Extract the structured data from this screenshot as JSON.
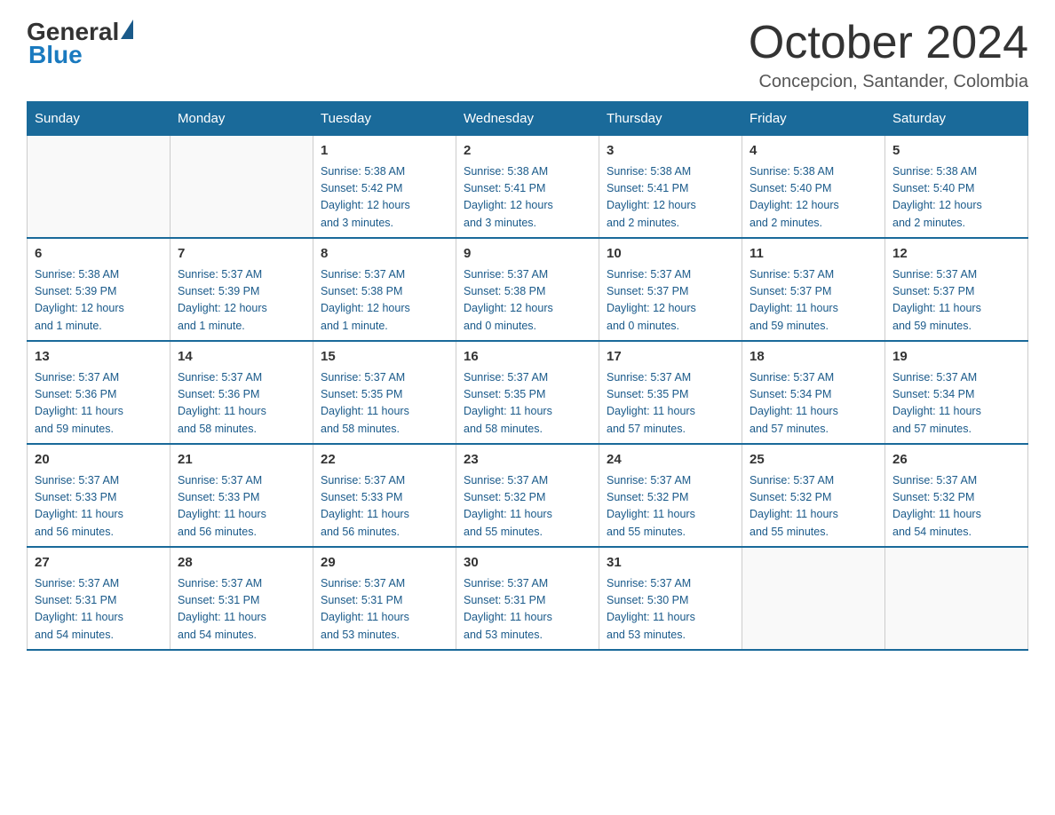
{
  "logo": {
    "general": "General",
    "triangle_color": "#1a5a8a",
    "blue": "Blue"
  },
  "header": {
    "title": "October 2024",
    "subtitle": "Concepcion, Santander, Colombia"
  },
  "weekdays": [
    "Sunday",
    "Monday",
    "Tuesday",
    "Wednesday",
    "Thursday",
    "Friday",
    "Saturday"
  ],
  "weeks": [
    [
      {
        "day": "",
        "info": ""
      },
      {
        "day": "",
        "info": ""
      },
      {
        "day": "1",
        "info": "Sunrise: 5:38 AM\nSunset: 5:42 PM\nDaylight: 12 hours\nand 3 minutes."
      },
      {
        "day": "2",
        "info": "Sunrise: 5:38 AM\nSunset: 5:41 PM\nDaylight: 12 hours\nand 3 minutes."
      },
      {
        "day": "3",
        "info": "Sunrise: 5:38 AM\nSunset: 5:41 PM\nDaylight: 12 hours\nand 2 minutes."
      },
      {
        "day": "4",
        "info": "Sunrise: 5:38 AM\nSunset: 5:40 PM\nDaylight: 12 hours\nand 2 minutes."
      },
      {
        "day": "5",
        "info": "Sunrise: 5:38 AM\nSunset: 5:40 PM\nDaylight: 12 hours\nand 2 minutes."
      }
    ],
    [
      {
        "day": "6",
        "info": "Sunrise: 5:38 AM\nSunset: 5:39 PM\nDaylight: 12 hours\nand 1 minute."
      },
      {
        "day": "7",
        "info": "Sunrise: 5:37 AM\nSunset: 5:39 PM\nDaylight: 12 hours\nand 1 minute."
      },
      {
        "day": "8",
        "info": "Sunrise: 5:37 AM\nSunset: 5:38 PM\nDaylight: 12 hours\nand 1 minute."
      },
      {
        "day": "9",
        "info": "Sunrise: 5:37 AM\nSunset: 5:38 PM\nDaylight: 12 hours\nand 0 minutes."
      },
      {
        "day": "10",
        "info": "Sunrise: 5:37 AM\nSunset: 5:37 PM\nDaylight: 12 hours\nand 0 minutes."
      },
      {
        "day": "11",
        "info": "Sunrise: 5:37 AM\nSunset: 5:37 PM\nDaylight: 11 hours\nand 59 minutes."
      },
      {
        "day": "12",
        "info": "Sunrise: 5:37 AM\nSunset: 5:37 PM\nDaylight: 11 hours\nand 59 minutes."
      }
    ],
    [
      {
        "day": "13",
        "info": "Sunrise: 5:37 AM\nSunset: 5:36 PM\nDaylight: 11 hours\nand 59 minutes."
      },
      {
        "day": "14",
        "info": "Sunrise: 5:37 AM\nSunset: 5:36 PM\nDaylight: 11 hours\nand 58 minutes."
      },
      {
        "day": "15",
        "info": "Sunrise: 5:37 AM\nSunset: 5:35 PM\nDaylight: 11 hours\nand 58 minutes."
      },
      {
        "day": "16",
        "info": "Sunrise: 5:37 AM\nSunset: 5:35 PM\nDaylight: 11 hours\nand 58 minutes."
      },
      {
        "day": "17",
        "info": "Sunrise: 5:37 AM\nSunset: 5:35 PM\nDaylight: 11 hours\nand 57 minutes."
      },
      {
        "day": "18",
        "info": "Sunrise: 5:37 AM\nSunset: 5:34 PM\nDaylight: 11 hours\nand 57 minutes."
      },
      {
        "day": "19",
        "info": "Sunrise: 5:37 AM\nSunset: 5:34 PM\nDaylight: 11 hours\nand 57 minutes."
      }
    ],
    [
      {
        "day": "20",
        "info": "Sunrise: 5:37 AM\nSunset: 5:33 PM\nDaylight: 11 hours\nand 56 minutes."
      },
      {
        "day": "21",
        "info": "Sunrise: 5:37 AM\nSunset: 5:33 PM\nDaylight: 11 hours\nand 56 minutes."
      },
      {
        "day": "22",
        "info": "Sunrise: 5:37 AM\nSunset: 5:33 PM\nDaylight: 11 hours\nand 56 minutes."
      },
      {
        "day": "23",
        "info": "Sunrise: 5:37 AM\nSunset: 5:32 PM\nDaylight: 11 hours\nand 55 minutes."
      },
      {
        "day": "24",
        "info": "Sunrise: 5:37 AM\nSunset: 5:32 PM\nDaylight: 11 hours\nand 55 minutes."
      },
      {
        "day": "25",
        "info": "Sunrise: 5:37 AM\nSunset: 5:32 PM\nDaylight: 11 hours\nand 55 minutes."
      },
      {
        "day": "26",
        "info": "Sunrise: 5:37 AM\nSunset: 5:32 PM\nDaylight: 11 hours\nand 54 minutes."
      }
    ],
    [
      {
        "day": "27",
        "info": "Sunrise: 5:37 AM\nSunset: 5:31 PM\nDaylight: 11 hours\nand 54 minutes."
      },
      {
        "day": "28",
        "info": "Sunrise: 5:37 AM\nSunset: 5:31 PM\nDaylight: 11 hours\nand 54 minutes."
      },
      {
        "day": "29",
        "info": "Sunrise: 5:37 AM\nSunset: 5:31 PM\nDaylight: 11 hours\nand 53 minutes."
      },
      {
        "day": "30",
        "info": "Sunrise: 5:37 AM\nSunset: 5:31 PM\nDaylight: 11 hours\nand 53 minutes."
      },
      {
        "day": "31",
        "info": "Sunrise: 5:37 AM\nSunset: 5:30 PM\nDaylight: 11 hours\nand 53 minutes."
      },
      {
        "day": "",
        "info": ""
      },
      {
        "day": "",
        "info": ""
      }
    ]
  ]
}
